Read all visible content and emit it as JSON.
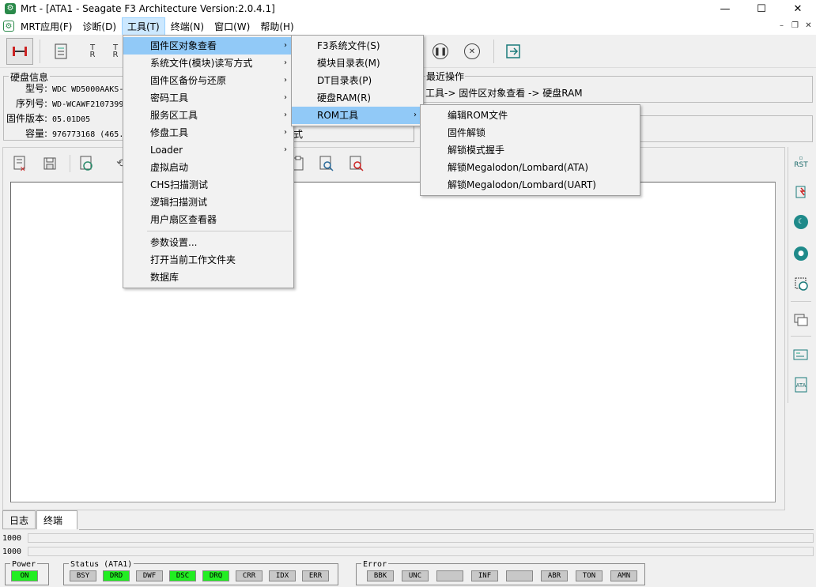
{
  "window": {
    "title": "Mrt - [ATA1 - Seagate F3 Architecture Version:2.0.4.1]",
    "icon": "app-icon",
    "minimize": "—",
    "maximize": "☐",
    "close": "✕"
  },
  "menubar": {
    "items": [
      "MRT应用(F)",
      "诊断(D)",
      "工具(T)",
      "终端(N)",
      "窗口(W)",
      "帮助(H)"
    ]
  },
  "disk_info": {
    "title": "硬盘信息",
    "model_label": "型号:",
    "model": "WDC WD5000AAKS-",
    "serial_label": "序列号:",
    "serial": "WD-WCAWF2107399",
    "firmware_label": "固件版本:",
    "firmware": "05.01D05",
    "capacity_label": "容量:",
    "capacity": "976773168 (465."
  },
  "recent": {
    "title": "最近操作",
    "path": "工具-> 固件区对象查看 -> 硬盘RAM"
  },
  "mode_fragment": "式",
  "tabs": [
    "日志",
    "终端"
  ],
  "progress": [
    "1000",
    "1000"
  ],
  "status_groups": {
    "power": {
      "title": "Power",
      "leds": [
        {
          "label": "ON",
          "on": true
        }
      ]
    },
    "status": {
      "title": "Status (ATA1)",
      "leds": [
        {
          "label": "BSY",
          "on": false
        },
        {
          "label": "DRD",
          "on": true
        },
        {
          "label": "DWF",
          "on": false
        },
        {
          "label": "DSC",
          "on": true
        },
        {
          "label": "DRQ",
          "on": true
        },
        {
          "label": "CRR",
          "on": false
        },
        {
          "label": "IDX",
          "on": false
        },
        {
          "label": "ERR",
          "on": false
        }
      ]
    },
    "error": {
      "title": "Error",
      "leds": [
        {
          "label": "BBK",
          "on": false
        },
        {
          "label": "UNC",
          "on": false
        },
        {
          "label": "",
          "on": false
        },
        {
          "label": "INF",
          "on": false
        },
        {
          "label": "",
          "on": false
        },
        {
          "label": "ABR",
          "on": false
        },
        {
          "label": "TON",
          "on": false
        },
        {
          "label": "AMN",
          "on": false
        }
      ]
    }
  },
  "tools_menu": {
    "items": [
      {
        "label": "固件区对象查看",
        "submenu": true
      },
      {
        "label": "系统文件(模块)读写方式",
        "submenu": true
      },
      {
        "label": "固件区备份与还原",
        "submenu": true
      },
      {
        "label": "密码工具",
        "submenu": true
      },
      {
        "label": "服务区工具",
        "submenu": true
      },
      {
        "label": "修盘工具",
        "submenu": true
      },
      {
        "label": "Loader",
        "submenu": true
      },
      {
        "label": "虚拟启动",
        "submenu": false
      },
      {
        "label": "CHS扫描测试",
        "submenu": false
      },
      {
        "label": "逻辑扫描测试",
        "submenu": false
      },
      {
        "label": "用户扇区查看器",
        "submenu": false
      },
      {
        "label": "参数设置...",
        "submenu": false
      },
      {
        "label": "打开当前工作文件夹",
        "submenu": false
      },
      {
        "label": "数据库",
        "submenu": false
      }
    ]
  },
  "firmware_submenu": {
    "items": [
      "F3系统文件(S)",
      "模块目录表(M)",
      "DT目录表(P)",
      "硬盘RAM(R)",
      "ROM工具"
    ]
  },
  "rom_submenu": {
    "items": [
      "编辑ROM文件",
      "固件解锁",
      "解锁模式握手",
      "解锁Megalodon/Lombard(ATA)",
      "解锁Megalodon/Lombard(UART)"
    ]
  },
  "side_labels": {
    "rst": "RST",
    "ata": "ATA"
  },
  "toolbar_texts": {
    "t1": "T",
    "t1b": "R",
    "t2": "T",
    "t2b": "R"
  },
  "icons": {
    "arrow": "›"
  }
}
